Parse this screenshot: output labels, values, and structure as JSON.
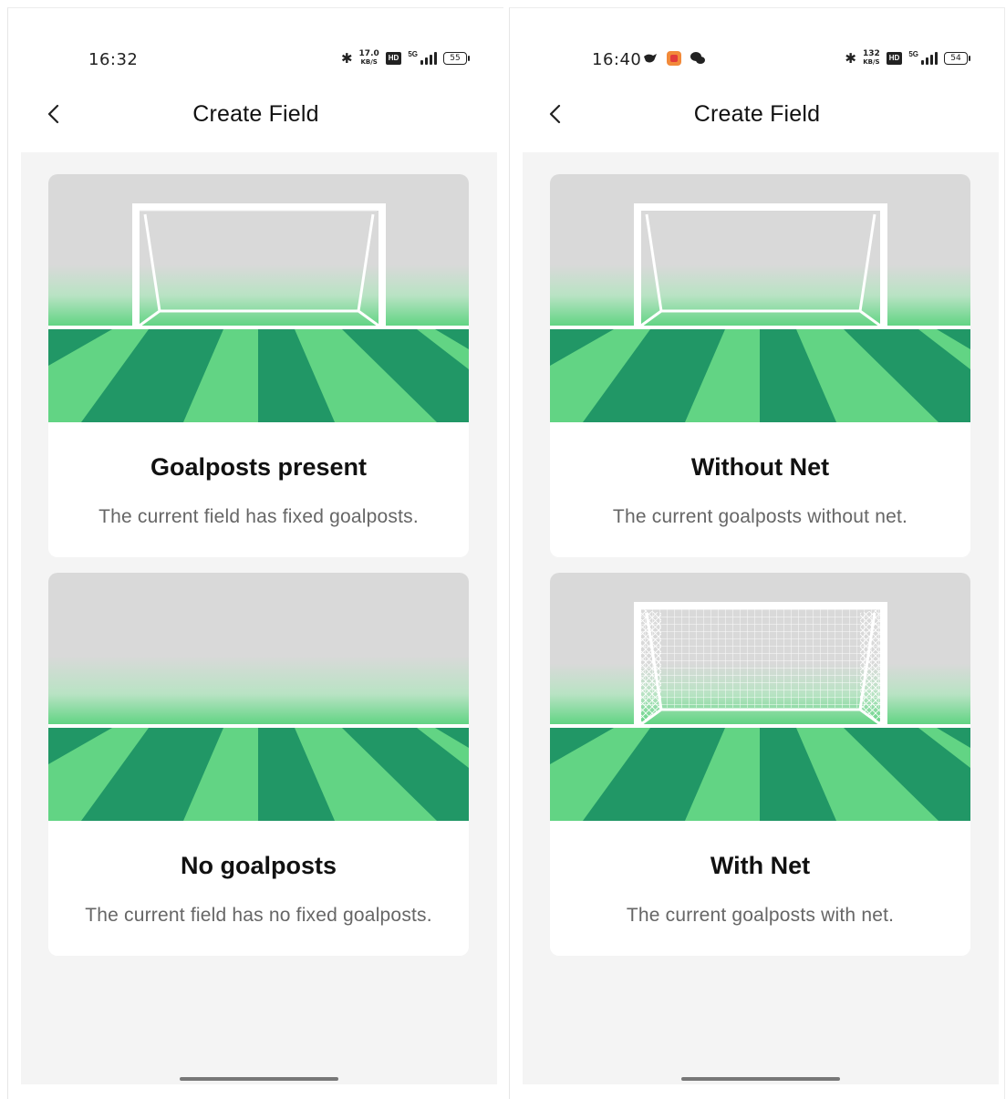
{
  "screens": [
    {
      "status": {
        "time": "16:32",
        "speed_top": "17.0",
        "speed_bottom": "KB/S",
        "hd": "HD",
        "network": "5G",
        "battery": "55"
      },
      "header": {
        "title": "Create Field"
      },
      "cards": [
        {
          "title": "Goalposts present",
          "description": "The current field has fixed goalposts.",
          "illustration": "goal-frame"
        },
        {
          "title": "No goalposts",
          "description": "The current field has no fixed goalposts.",
          "illustration": "empty-field"
        }
      ]
    },
    {
      "status": {
        "time": "16:40",
        "speed_top": "132",
        "speed_bottom": "KB/S",
        "hd": "HD",
        "network": "5G",
        "battery": "54"
      },
      "header": {
        "title": "Create Field"
      },
      "cards": [
        {
          "title": "Without Net",
          "description": "The current goalposts without net.",
          "illustration": "goal-frame"
        },
        {
          "title": "With Net",
          "description": "The current goalposts with net.",
          "illustration": "goal-net"
        }
      ]
    }
  ],
  "colors": {
    "grass_light": "#62d484",
    "grass_dark": "#219766",
    "sky": "#d9d9d9",
    "card_bg": "#ffffff",
    "page_bg": "#f4f4f4"
  }
}
